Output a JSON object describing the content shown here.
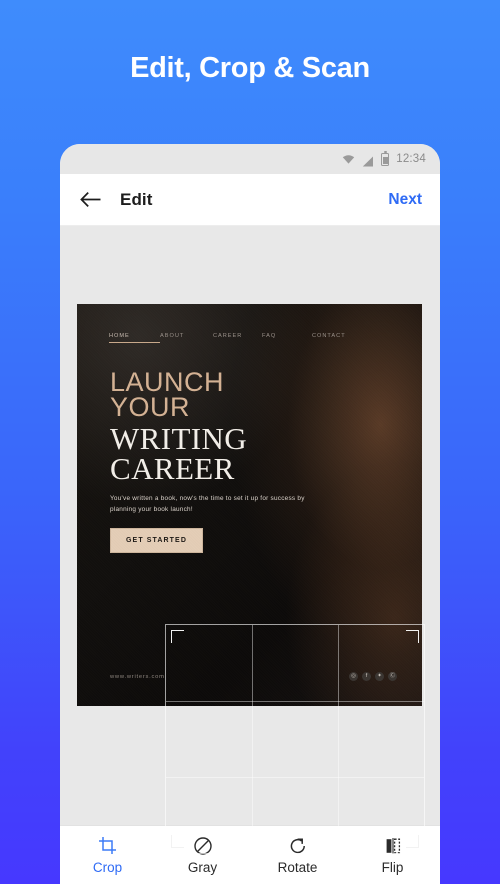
{
  "promo": {
    "headline": "Edit, Crop & Scan"
  },
  "theme": {
    "bg_gradient_top": "#3f8cfc",
    "bg_gradient_bottom": "#4638ff",
    "accent": "#2f6bf5",
    "canvas_bg": "#e8e8e8",
    "statusbar_bg": "#e7e7e7"
  },
  "phone": {
    "statusbar": {
      "time": "12:34",
      "icons": [
        "wifi-icon",
        "signal-icon",
        "battery-icon"
      ]
    },
    "appbar": {
      "back_icon": "arrow-left-icon",
      "title": "Edit",
      "action_label": "Next"
    },
    "toolbar": {
      "items": [
        {
          "label": "Crop",
          "icon": "crop-icon",
          "active": true
        },
        {
          "label": "Gray",
          "icon": "grayscale-icon",
          "active": false
        },
        {
          "label": "Rotate",
          "icon": "rotate-icon",
          "active": false
        },
        {
          "label": "Flip",
          "icon": "flip-icon",
          "active": false
        }
      ]
    }
  },
  "editor": {
    "crop_overlay": {
      "grid": "rule-of-thirds",
      "handles": [
        "top-left",
        "top-right",
        "bottom-left",
        "bottom-right"
      ]
    }
  },
  "poster": {
    "nav": [
      "HOME",
      "ABOUT",
      "CAREER",
      "FAQ",
      "CONTACT"
    ],
    "active_nav": "HOME",
    "kicker_line1": "LAUNCH",
    "kicker_line2": "YOUR",
    "headline_line1": "WRITING",
    "headline_line2": "CAREER",
    "body": "You've written a book, now's the time to set it up for success by planning your book launch!",
    "cta_label": "GET STARTED",
    "url": "www.writers.com",
    "social_icons": [
      "instagram-icon",
      "facebook-icon",
      "twitter-icon",
      "pinterest-icon"
    ],
    "colors": {
      "kicker": "#d5b294",
      "headline": "#f3efe9",
      "cta_bg": "#e4cdb6"
    }
  }
}
